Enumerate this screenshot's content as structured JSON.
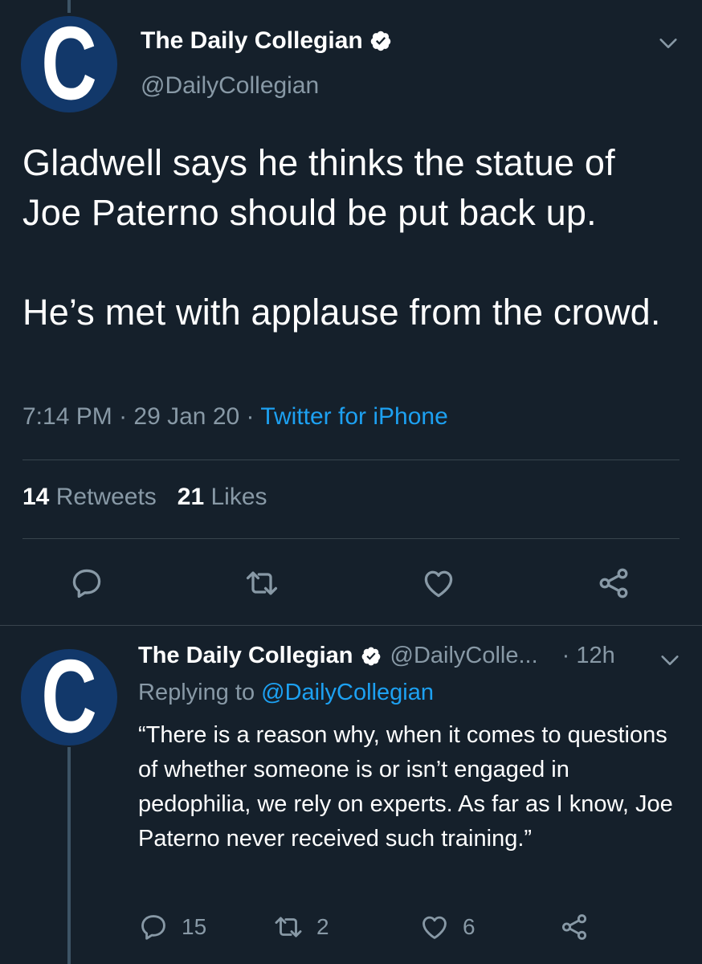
{
  "main_tweet": {
    "display_name": "The Daily Collegian",
    "handle": "@DailyCollegian",
    "avatar_letter": "C",
    "text": "Gladwell says he thinks the statue of Joe Paterno should be put back up.\n\nHe’s met with applause from the crowd.",
    "time": "7:14 PM",
    "date": "29 Jan 20",
    "source": "Twitter for iPhone",
    "separator": " · ",
    "retweets_count": "14",
    "retweets_label": "Retweets",
    "likes_count": "21",
    "likes_label": "Likes"
  },
  "reply_tweet": {
    "display_name": "The Daily Collegian",
    "handle": "@DailyColle...",
    "time": "· 12h",
    "avatar_letter": "C",
    "replying_prefix": "Replying to ",
    "replying_to": "@DailyCollegian",
    "text": "“There is a reason why, when it comes to questions of whether someone is or isn’t engaged in pedophilia, we rely on experts. As far as I know, Joe Paterno never received such training.”",
    "reply_count": "15",
    "retweet_count": "2",
    "like_count": "6"
  },
  "colors": {
    "background": "#15202b",
    "secondary_text": "#8899a6",
    "link": "#1da1f2",
    "avatar_bg": "#12386a",
    "divider": "#38444d"
  },
  "icons": [
    "verified-badge-icon",
    "chevron-down-icon",
    "reply-icon",
    "retweet-icon",
    "like-icon",
    "share-icon"
  ]
}
